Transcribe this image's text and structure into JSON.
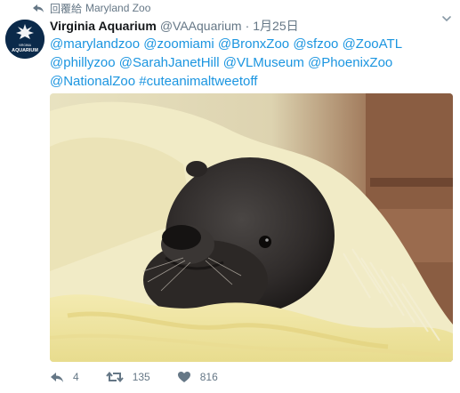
{
  "context": {
    "label": "回覆給",
    "user": "Maryland Zoo"
  },
  "tweet": {
    "display_name": "Virginia Aquarium",
    "handle": "@VAAquarium",
    "separator": "·",
    "time": "1月25日",
    "text_lines": [
      [
        "@marylandzoo",
        "@zoomiami",
        "@BronxZoo",
        "@sfzoo",
        "@ZooATL"
      ],
      [
        "@phillyzoo",
        "@SarahJanetHill",
        "@VLMuseum",
        "@PhoenixZoo"
      ],
      [
        "@NationalZoo",
        "#cuteanimaltweetoff"
      ]
    ]
  },
  "avatar": {
    "small_text": "VIRGINIA",
    "big_text": "AQUARIUM",
    "bg": "#0b2a4a"
  },
  "actions": {
    "reply_count": "4",
    "retweet_count": "135",
    "like_count": "816"
  },
  "colors": {
    "link": "#1b95e0",
    "muted": "#657786",
    "name": "#14171a"
  },
  "icons": {
    "reply": "reply-icon",
    "retweet": "retweet-icon",
    "like": "heart-icon",
    "caret": "chevron-down-icon",
    "context": "reply-arrow-icon"
  }
}
